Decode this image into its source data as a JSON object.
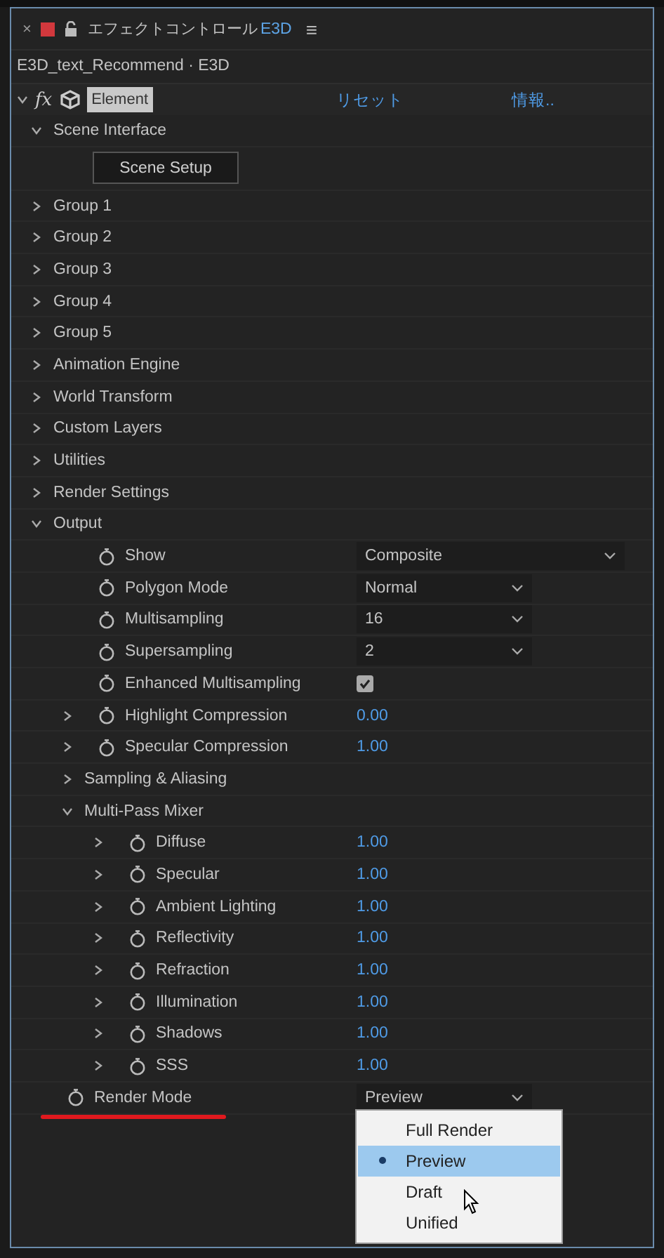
{
  "panel": {
    "close": "×",
    "title": "エフェクトコントロール",
    "layer": "E3D",
    "menu": "≡"
  },
  "subtitle": "E3D_text_Recommend · E3D",
  "effect": {
    "expanded": true,
    "fx": "fx",
    "name": "Element",
    "reset": "リセット",
    "about": "情報..",
    "children": [
      {
        "kind": "group",
        "label": "Scene Interface",
        "expanded": true,
        "children": [
          {
            "kind": "button",
            "label": "Scene Setup"
          }
        ]
      },
      {
        "kind": "group",
        "label": "Group 1",
        "expanded": false
      },
      {
        "kind": "group",
        "label": "Group 2",
        "expanded": false
      },
      {
        "kind": "group",
        "label": "Group 3",
        "expanded": false
      },
      {
        "kind": "group",
        "label": "Group 4",
        "expanded": false
      },
      {
        "kind": "group",
        "label": "Group 5",
        "expanded": false
      },
      {
        "kind": "group",
        "label": "Animation Engine",
        "expanded": false
      },
      {
        "kind": "group",
        "label": "World Transform",
        "expanded": false
      },
      {
        "kind": "group",
        "label": "Custom Layers",
        "expanded": false
      },
      {
        "kind": "group",
        "label": "Utilities",
        "expanded": false
      },
      {
        "kind": "group",
        "label": "Render Settings",
        "expanded": false
      },
      {
        "kind": "group",
        "label": "Output",
        "expanded": true,
        "children": [
          {
            "kind": "param",
            "label": "Show",
            "control": {
              "kind": "dropdown",
              "value": "Composite",
              "wide": true,
              "open": false
            }
          },
          {
            "kind": "param",
            "label": "Polygon Mode",
            "control": {
              "kind": "dropdown",
              "value": "Normal",
              "wide": false,
              "open": false
            }
          },
          {
            "kind": "param",
            "label": "Multisampling",
            "control": {
              "kind": "dropdown",
              "value": "16",
              "wide": false,
              "open": false
            }
          },
          {
            "kind": "param",
            "label": "Supersampling",
            "control": {
              "kind": "dropdown",
              "value": "2",
              "wide": false,
              "open": false
            }
          },
          {
            "kind": "param",
            "label": "Enhanced Multisampling",
            "control": {
              "kind": "checkbox",
              "checked": true
            }
          },
          {
            "kind": "param",
            "label": "Highlight Compression",
            "expanded": false,
            "control": {
              "kind": "number",
              "value": "0.00"
            }
          },
          {
            "kind": "param",
            "label": "Specular Compression",
            "expanded": false,
            "control": {
              "kind": "number",
              "value": "1.00"
            }
          },
          {
            "kind": "group",
            "label": "Sampling & Aliasing",
            "expanded": false
          },
          {
            "kind": "group",
            "label": "Multi-Pass Mixer",
            "expanded": true,
            "children": [
              {
                "kind": "param",
                "label": "Diffuse",
                "expanded": false,
                "control": {
                  "kind": "number",
                  "value": "1.00"
                }
              },
              {
                "kind": "param",
                "label": "Specular",
                "expanded": false,
                "control": {
                  "kind": "number",
                  "value": "1.00"
                }
              },
              {
                "kind": "param",
                "label": "Ambient Lighting",
                "expanded": false,
                "control": {
                  "kind": "number",
                  "value": "1.00"
                }
              },
              {
                "kind": "param",
                "label": "Reflectivity",
                "expanded": false,
                "control": {
                  "kind": "number",
                  "value": "1.00"
                }
              },
              {
                "kind": "param",
                "label": "Refraction",
                "expanded": false,
                "control": {
                  "kind": "number",
                  "value": "1.00"
                }
              },
              {
                "kind": "param",
                "label": "Illumination",
                "expanded": false,
                "control": {
                  "kind": "number",
                  "value": "1.00"
                }
              },
              {
                "kind": "param",
                "label": "Shadows",
                "expanded": false,
                "control": {
                  "kind": "number",
                  "value": "1.00"
                }
              },
              {
                "kind": "param",
                "label": "SSS",
                "expanded": false,
                "control": {
                  "kind": "number",
                  "value": "1.00"
                }
              }
            ]
          }
        ]
      },
      {
        "kind": "param",
        "label": "Render Mode",
        "underlined": true,
        "control": {
          "kind": "dropdown",
          "value": "Preview",
          "wide": false,
          "open": true,
          "options": [
            {
              "label": "Full Render",
              "selected": false
            },
            {
              "label": "Preview",
              "selected": true
            },
            {
              "label": "Draft",
              "selected": false
            },
            {
              "label": "Unified",
              "selected": false
            }
          ]
        }
      }
    ]
  }
}
